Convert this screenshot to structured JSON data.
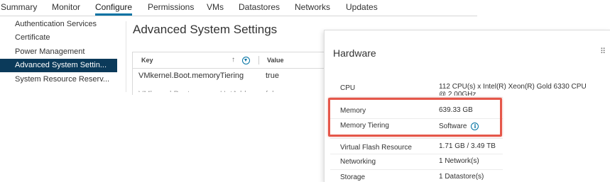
{
  "tabs": [
    {
      "label": "Summary"
    },
    {
      "label": "Monitor"
    },
    {
      "label": "Configure"
    },
    {
      "label": "Permissions"
    },
    {
      "label": "VMs"
    },
    {
      "label": "Datastores"
    },
    {
      "label": "Networks"
    },
    {
      "label": "Updates"
    }
  ],
  "active_tab": "Configure",
  "sidebar": {
    "items": [
      {
        "label": "Authentication Services"
      },
      {
        "label": "Certificate"
      },
      {
        "label": "Power Management"
      },
      {
        "label": "Advanced System Settin..."
      },
      {
        "label": "System Resource Reserv..."
      }
    ],
    "active_item": "Advanced System Settin..."
  },
  "main": {
    "title": "Advanced System Settings",
    "table": {
      "columns": [
        "Key",
        "Value"
      ],
      "rows": [
        {
          "key": "VMkernel.Boot.memoryTiering",
          "value": "true"
        },
        {
          "key": "VMkernel.Boot.memoryHotAdd...",
          "value": "false"
        }
      ]
    }
  },
  "hardware": {
    "title": "Hardware",
    "rows": [
      {
        "label": "CPU",
        "value": "112 CPU(s) x Intel(R) Xeon(R) Gold 6330 CPU",
        "value_cont": "@ 2.00GHz"
      },
      {
        "label": "Memory",
        "value": "639.33 GB"
      },
      {
        "label": "Memory Tiering",
        "value": "Software"
      },
      {
        "label": "Virtual Flash Resource",
        "value": "1.71 GB / 3.49 TB"
      },
      {
        "label": "Networking",
        "value": "1 Network(s)"
      },
      {
        "label": "Storage",
        "value": "1 Datastore(s)"
      }
    ]
  },
  "colors": {
    "accent": "#0072a3",
    "sidebar_active_bg": "#0b3a5a",
    "highlight": "#e5574a"
  },
  "icons": {
    "sort": "arrow-up-icon",
    "filter": "filter-icon",
    "info": "info-icon",
    "drag": "drag-handle-icon"
  }
}
